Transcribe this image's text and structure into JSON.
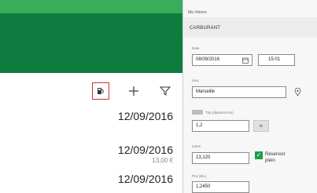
{
  "left": {
    "toolbar": {
      "fuel_icon": "fuel-pump-icon",
      "add_icon": "plus-icon",
      "filter_icon": "filter-icon"
    },
    "list": [
      {
        "date": "12/09/2016",
        "amount": ""
      },
      {
        "date": "12/09/2016",
        "amount": "13,00 €"
      },
      {
        "date": "12/09/2016",
        "amount": ""
      }
    ]
  },
  "form": {
    "app_title": "Ma Voiture",
    "section": "CARBURANT",
    "date_label": "Date",
    "date_value": "08/09/2016",
    "time_value": "15:01",
    "place_label": "Lieu",
    "place_value": "Marseille",
    "trip_label": "Trip (distance km)",
    "trip_value": "1,2",
    "liters_label": "Litres",
    "liters_value": "13,120",
    "full_tank_label_1": "Réservoir",
    "full_tank_label_2": "plein",
    "price_label": "Prix (€/L)",
    "price_value": "1,2450"
  },
  "colors": {
    "green_dark": "#0f7b3e",
    "green_light": "#3aad5a",
    "highlight": "#d32f2f"
  }
}
